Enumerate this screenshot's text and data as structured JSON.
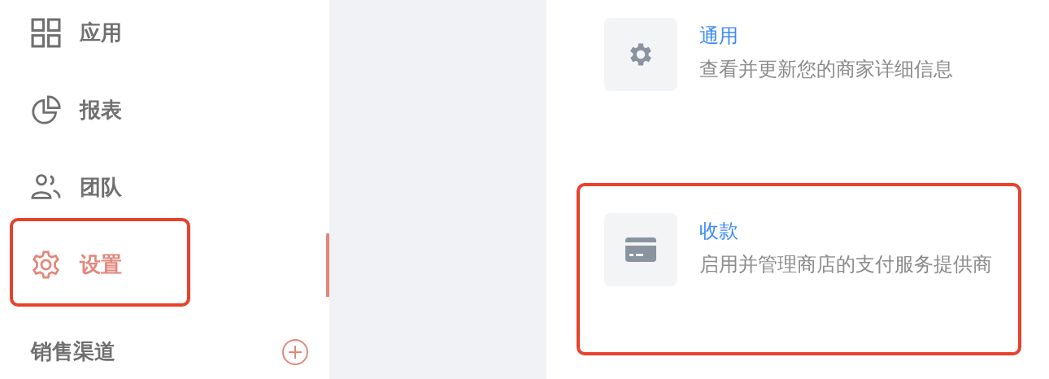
{
  "sidebar": {
    "items": [
      {
        "kind": "grid",
        "label": "应用",
        "selected": false,
        "highlighted": false
      },
      {
        "kind": "pie",
        "label": "报表",
        "selected": false,
        "highlighted": false
      },
      {
        "kind": "team",
        "label": "团队",
        "selected": false,
        "highlighted": false
      },
      {
        "kind": "gear",
        "label": "设置",
        "selected": true,
        "highlighted": true
      }
    ],
    "section": {
      "label": "销售渠道"
    }
  },
  "settings": [
    {
      "kind": "gear",
      "title": "通用",
      "description": "查看并更新您的商家详细信息",
      "highlighted": false
    },
    {
      "kind": "card",
      "title": "收款",
      "description": "启用并管理商店的支付服务提供商",
      "highlighted": true
    }
  ]
}
